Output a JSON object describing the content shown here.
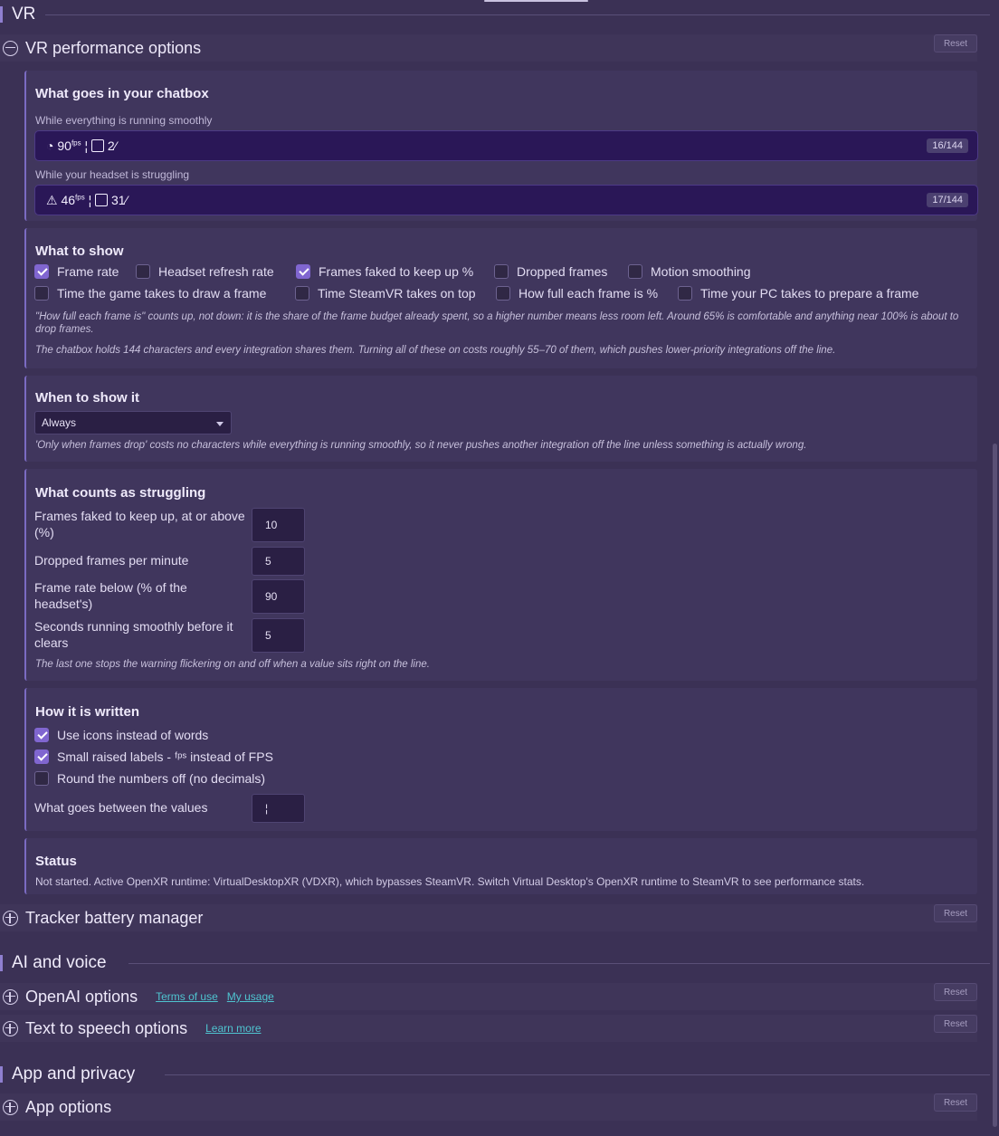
{
  "sections": {
    "vr": "VR",
    "ai": "AI and voice",
    "app": "App and privacy"
  },
  "vr_perf": {
    "title": "VR performance options",
    "reset": "Reset"
  },
  "chatbox_card": {
    "title": "What goes in your chatbox",
    "smooth_label": "While everything is running smoothly",
    "smooth_preview": "☰ 90ᶠᵖˢ ¦ ⧉ 2⁄",
    "smooth_fps": "90",
    "smooth_fps_sup": "fps",
    "smooth_pct": "2⁄",
    "smooth_count": "16/144",
    "struggle_label": "While your headset is struggling",
    "struggle_fps": "46",
    "struggle_fps_sup": "fps",
    "struggle_pct": "31⁄",
    "struggle_count": "17/144",
    "separator": "¦"
  },
  "show_card": {
    "title": "What to show",
    "options": [
      {
        "label": "Frame rate",
        "checked": true
      },
      {
        "label": "Headset refresh rate",
        "checked": false
      },
      {
        "label": "Frames faked to keep up %",
        "checked": true
      },
      {
        "label": "Dropped frames",
        "checked": false
      },
      {
        "label": "Motion smoothing",
        "checked": false
      },
      {
        "label": "Time the game takes to draw a frame",
        "checked": false
      },
      {
        "label": "Time SteamVR takes on top",
        "checked": false
      },
      {
        "label": "How full each frame is %",
        "checked": false
      },
      {
        "label": "Time your PC takes to prepare a frame",
        "checked": false
      }
    ],
    "note1": "\"How full each frame is\" counts up, not down: it is the share of the frame budget already spent, so a higher number means less room left. Around 65% is comfortable and anything near 100% is about to drop frames.",
    "note2": "The chatbox holds 144 characters and every integration shares them. Turning all of these on costs roughly 55–70 of them, which pushes lower-priority integrations off the line."
  },
  "when_card": {
    "title": "When to show it",
    "selected": "Always",
    "note": "'Only when frames drop' costs no characters while everything is running smoothly, so it never pushes another integration off the line unless something is actually wrong."
  },
  "struggle_card": {
    "title": "What counts as struggling",
    "fields": [
      {
        "label": "Frames faked to keep up, at or above (%)",
        "value": "10"
      },
      {
        "label": "Dropped frames per minute",
        "value": "5"
      },
      {
        "label": "Frame rate below (% of the headset's)",
        "value": "90"
      },
      {
        "label": "Seconds running smoothly before it clears",
        "value": "5"
      }
    ],
    "note": "The last one stops the warning flickering on and off when a value sits right on the line."
  },
  "written_card": {
    "title": "How it is written",
    "options": [
      {
        "label": "Use icons instead of words",
        "checked": true
      },
      {
        "label": "Small raised labels - ᶠᵖˢ instead of FPS",
        "checked": true
      },
      {
        "label": "Round the numbers off (no decimals)",
        "checked": false
      }
    ],
    "sep_label": "What goes between the values",
    "sep_value": "¦"
  },
  "status_card": {
    "title": "Status",
    "text": "Not started. Active OpenXR runtime: VirtualDesktopXR (VDXR), which bypasses SteamVR. Switch Virtual Desktop's OpenXR runtime to SteamVR to see performance stats."
  },
  "tracker": {
    "title": "Tracker battery manager",
    "reset": "Reset"
  },
  "openai": {
    "title": "OpenAI options",
    "link1": "Terms of use",
    "link2": "My usage",
    "reset": "Reset"
  },
  "tts": {
    "title": "Text to speech options",
    "link": "Learn more",
    "reset": "Reset"
  },
  "appopts": {
    "title": "App options",
    "reset": "Reset"
  },
  "colors": {
    "background": "#3b3155",
    "accent": "#8066d0",
    "link": "#4fc4d0",
    "chatbox": "#2a1757"
  }
}
